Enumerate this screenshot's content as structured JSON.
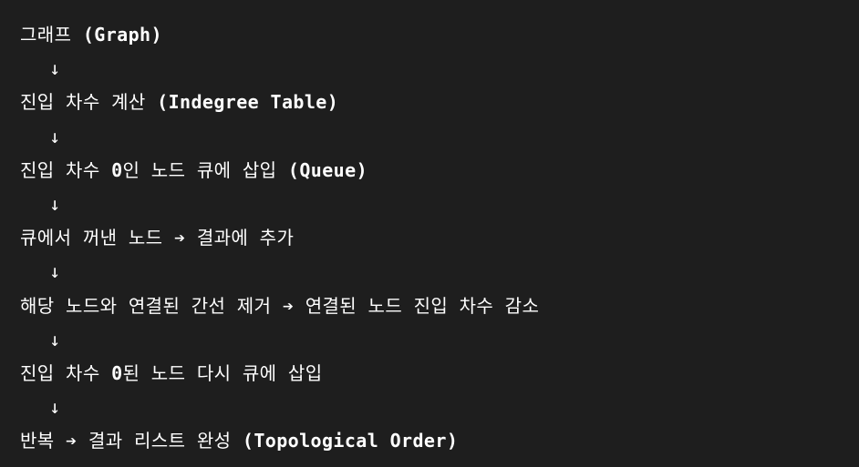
{
  "flow": {
    "steps": [
      {
        "pre": "그래프 ",
        "bold": "(Graph)",
        "mid": "",
        "bold2": "",
        "post": ""
      },
      {
        "pre": "진입 차수 계산 ",
        "bold": "(Indegree Table)",
        "mid": "",
        "bold2": "",
        "post": ""
      },
      {
        "pre": "진입 차수 ",
        "bold": "0",
        "mid": "인 노드 큐에 삽입 ",
        "bold2": "(Queue)",
        "post": ""
      },
      {
        "pre": "큐에서 꺼낸 노드 ",
        "bold": "➔",
        "mid": " 결과에 추가",
        "bold2": "",
        "post": ""
      },
      {
        "pre": "해당 노드와 연결된 간선 제거 ",
        "bold": "➔",
        "mid": " 연결된 노드 진입 차수 감소",
        "bold2": "",
        "post": ""
      },
      {
        "pre": "진입 차수 ",
        "bold": "0",
        "mid": "된 노드 다시 큐에 삽입",
        "bold2": "",
        "post": ""
      },
      {
        "pre": "반복 ",
        "bold": "➔",
        "mid": " 결과 리스트 완성 ",
        "bold2": "(Topological Order)",
        "post": ""
      }
    ],
    "arrow": "↓"
  }
}
